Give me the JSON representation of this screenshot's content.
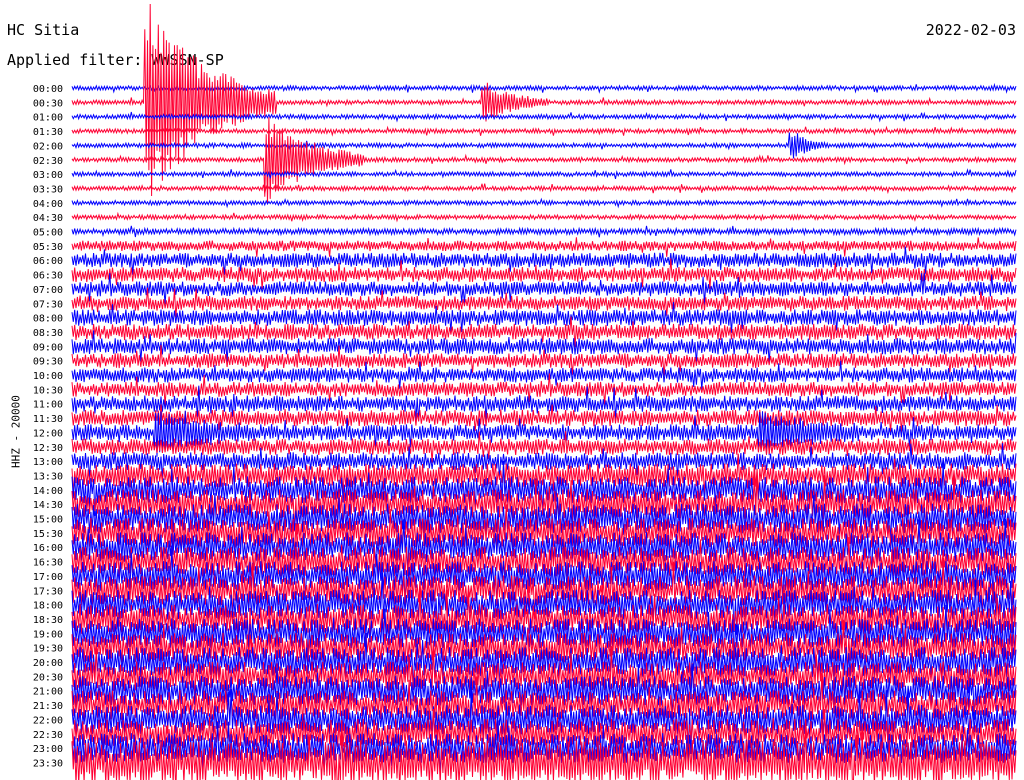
{
  "header": {
    "station": "HC Sitia",
    "date": "2022-02-03",
    "filter_text": "Applied filter: WWSSN-SP"
  },
  "chart_data": {
    "type": "line",
    "title": "HC Sitia",
    "ylabel": "HHZ - 20000",
    "row_labels": [
      "00:00",
      "00:30",
      "01:00",
      "01:30",
      "02:00",
      "02:30",
      "03:00",
      "03:30",
      "04:00",
      "04:30",
      "05:00",
      "05:30",
      "06:00",
      "06:30",
      "07:00",
      "07:30",
      "08:00",
      "08:30",
      "09:00",
      "09:30",
      "10:00",
      "10:30",
      "11:00",
      "11:30",
      "12:00",
      "12:30",
      "13:00",
      "13:30",
      "14:00",
      "14:30",
      "15:00",
      "15:30",
      "16:00",
      "16:30",
      "17:00",
      "17:30",
      "18:00",
      "18:30",
      "19:00",
      "19:30",
      "20:00",
      "20:30",
      "21:00",
      "21:30",
      "22:00",
      "22:30",
      "23:00",
      "23:30"
    ],
    "row_minutes": 30,
    "colors": [
      "#0000ff",
      "#ff0033"
    ],
    "noise_level": [
      0.15,
      0.15,
      0.15,
      0.15,
      0.15,
      0.15,
      0.15,
      0.15,
      0.15,
      0.15,
      0.2,
      0.35,
      0.5,
      0.5,
      0.5,
      0.5,
      0.55,
      0.55,
      0.55,
      0.5,
      0.5,
      0.5,
      0.55,
      0.55,
      0.55,
      0.55,
      0.6,
      0.8,
      0.9,
      1.0,
      1.0,
      1.0,
      1.0,
      1.0,
      1.0,
      1.0,
      1.0,
      1.0,
      1.0,
      1.0,
      1.0,
      1.0,
      1.0,
      1.0,
      1.0,
      1.0,
      1.0,
      1.5
    ],
    "events": [
      {
        "row": 1,
        "minute": 2.5,
        "amplitude": 14,
        "duration_min": 4
      },
      {
        "row": 5,
        "minute": 6.3,
        "amplitude": 6,
        "duration_min": 3
      },
      {
        "row": 1,
        "minute": 13.2,
        "amplitude": 2.5,
        "duration_min": 2
      },
      {
        "row": 24,
        "minute": 2.8,
        "amplitude": 2.5,
        "duration_min": 3
      },
      {
        "row": 24,
        "minute": 22.0,
        "amplitude": 2.5,
        "duration_min": 3
      },
      {
        "row": 4,
        "minute": 23.0,
        "amplitude": 1.8,
        "duration_min": 1
      }
    ]
  }
}
